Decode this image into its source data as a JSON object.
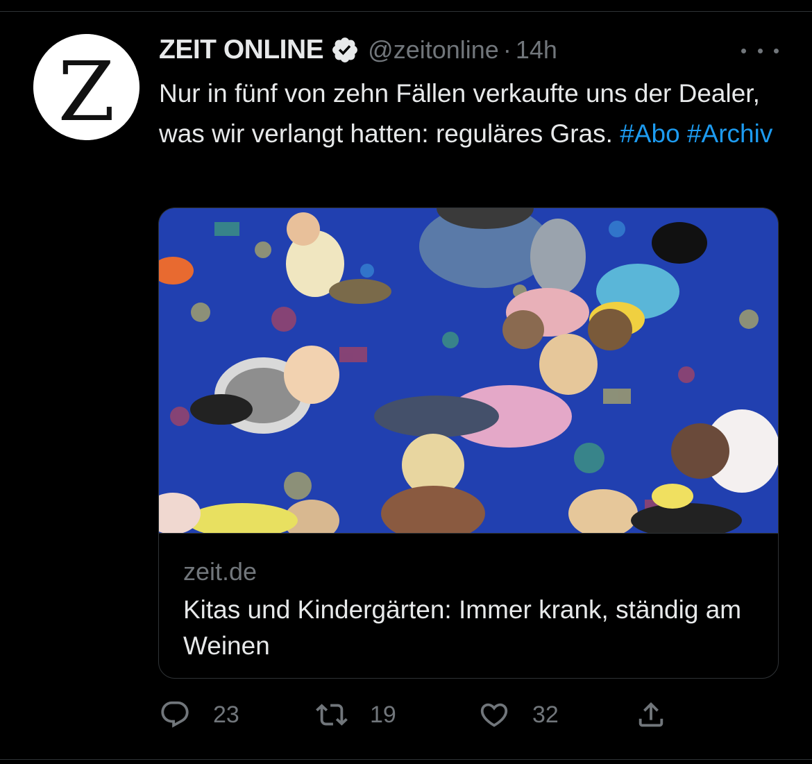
{
  "tweet": {
    "author": {
      "display_name": "ZEIT ONLINE",
      "handle": "@zeitonline",
      "verified": true,
      "avatar_letter": "Z"
    },
    "separator": "·",
    "time": "14h",
    "text_main": "Nur in fünf von zehn Fällen verkaufte uns der Dealer, was wir verlangt hatten: reguläres Gras.",
    "hashtags": [
      "#Abo",
      "#Archiv"
    ],
    "card": {
      "domain": "zeit.de",
      "title": "Kitas und Kindergärten: Immer krank, ständig am Weinen"
    },
    "actions": {
      "reply_count": "23",
      "retweet_count": "19",
      "like_count": "32"
    }
  },
  "icons": {
    "verified": "verified-badge-icon",
    "more": "more-options-icon",
    "reply": "reply-icon",
    "retweet": "retweet-icon",
    "like": "heart-icon",
    "share": "share-icon"
  },
  "colors": {
    "background": "#000000",
    "text": "#e7e9ea",
    "secondary": "#71767b",
    "link": "#1d9bf0",
    "border": "#2f3336"
  }
}
